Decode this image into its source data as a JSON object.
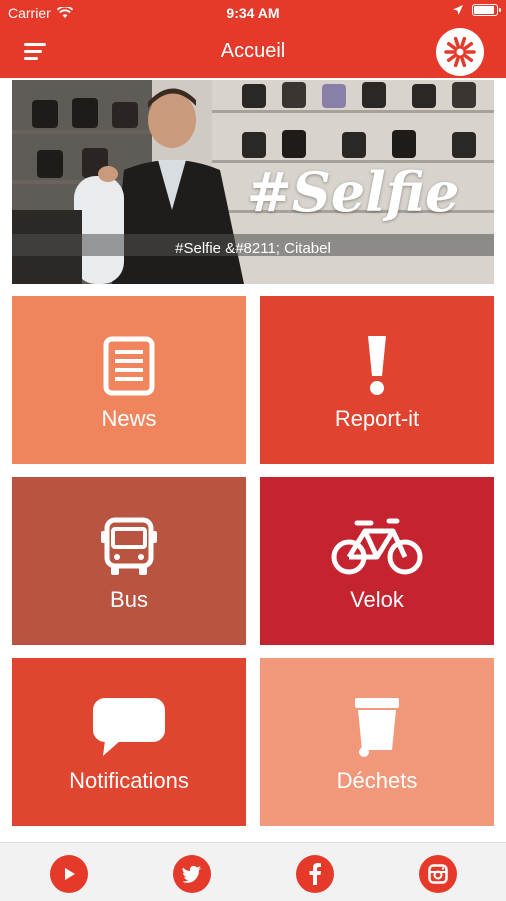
{
  "status_bar": {
    "carrier": "Carrier",
    "time": "9:34 AM",
    "battery_level": 0.9
  },
  "nav": {
    "title": "Accueil",
    "menu_icon": "hamburger-menu-icon",
    "logo_icon": "citabel-logo-icon"
  },
  "hero": {
    "caption": "#Selfie &#8211; Citabel",
    "overlay_text": "#Selfie"
  },
  "tiles": [
    {
      "label": "News",
      "icon": "news-document-icon",
      "color": "#f0845c"
    },
    {
      "label": "Report-it",
      "icon": "exclamation-icon",
      "color": "#e0432f"
    },
    {
      "label": "Bus",
      "icon": "bus-icon",
      "color": "#b85440"
    },
    {
      "label": "Velok",
      "icon": "bicycle-icon",
      "color": "#c4232f"
    },
    {
      "label": "Notifications",
      "icon": "chat-bubble-icon",
      "color": "#df452f"
    },
    {
      "label": "Déchets",
      "icon": "trash-bin-icon",
      "color": "#f2987a"
    }
  ],
  "social": [
    {
      "icon": "youtube-icon"
    },
    {
      "icon": "twitter-icon"
    },
    {
      "icon": "facebook-icon"
    },
    {
      "icon": "instagram-icon"
    }
  ],
  "colors": {
    "brand": "#e5392a",
    "bottom_bar": "#f2f2f2"
  }
}
